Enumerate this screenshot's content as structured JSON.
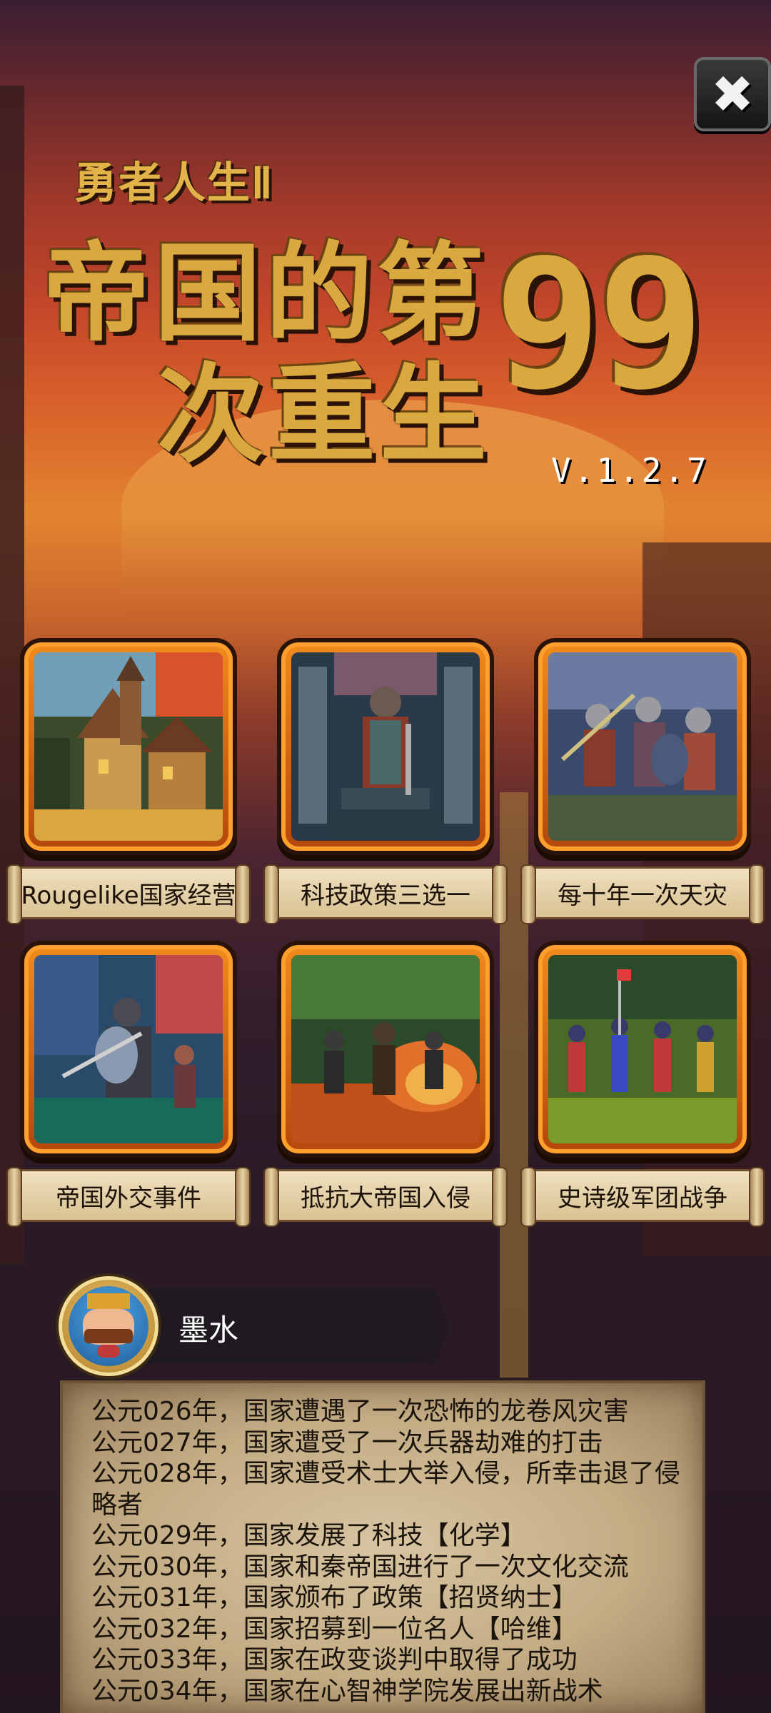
{
  "close_button": {
    "icon": "close-icon",
    "glyph": "✖"
  },
  "title": {
    "subtitle": "勇者人生Ⅱ",
    "line1": "帝国的第",
    "line2": "次重生",
    "number": "99",
    "version": "V.1.2.7"
  },
  "features": [
    {
      "label": "Rougelike国家经营",
      "image": "medieval-town-image"
    },
    {
      "label": "科技政策三选一",
      "image": "knight-statue-image"
    },
    {
      "label": "每十年一次天灾",
      "image": "soldiers-charge-image"
    },
    {
      "label": "帝国外交事件",
      "image": "knight-battle-image"
    },
    {
      "label": "抵抗大帝国入侵",
      "image": "burning-battle-image"
    },
    {
      "label": "史诗级军团战争",
      "image": "army-march-image"
    }
  ],
  "player": {
    "name": "墨水",
    "avatar": "king-avatar"
  },
  "event_log": [
    "公元026年，国家遭遇了一次恐怖的龙卷风灾害",
    "公元027年，国家遭受了一次兵器劫难的打击",
    "公元028年，国家遭受术士大举入侵，所幸击退了侵略者",
    "公元029年，国家发展了科技【化学】",
    "公元030年，国家和秦帝国进行了一次文化交流",
    "公元031年，国家颁布了政策【招贤纳士】",
    "公元032年，国家招募到一位名人【哈维】",
    "公元033年，国家在政变谈判中取得了成功",
    "公元034年，国家在心智神学院发展出新战术"
  ],
  "colors": {
    "title_gold": "#d9a83e",
    "card_orange": "#f08b1c",
    "parchment": "#d7c4a1"
  }
}
